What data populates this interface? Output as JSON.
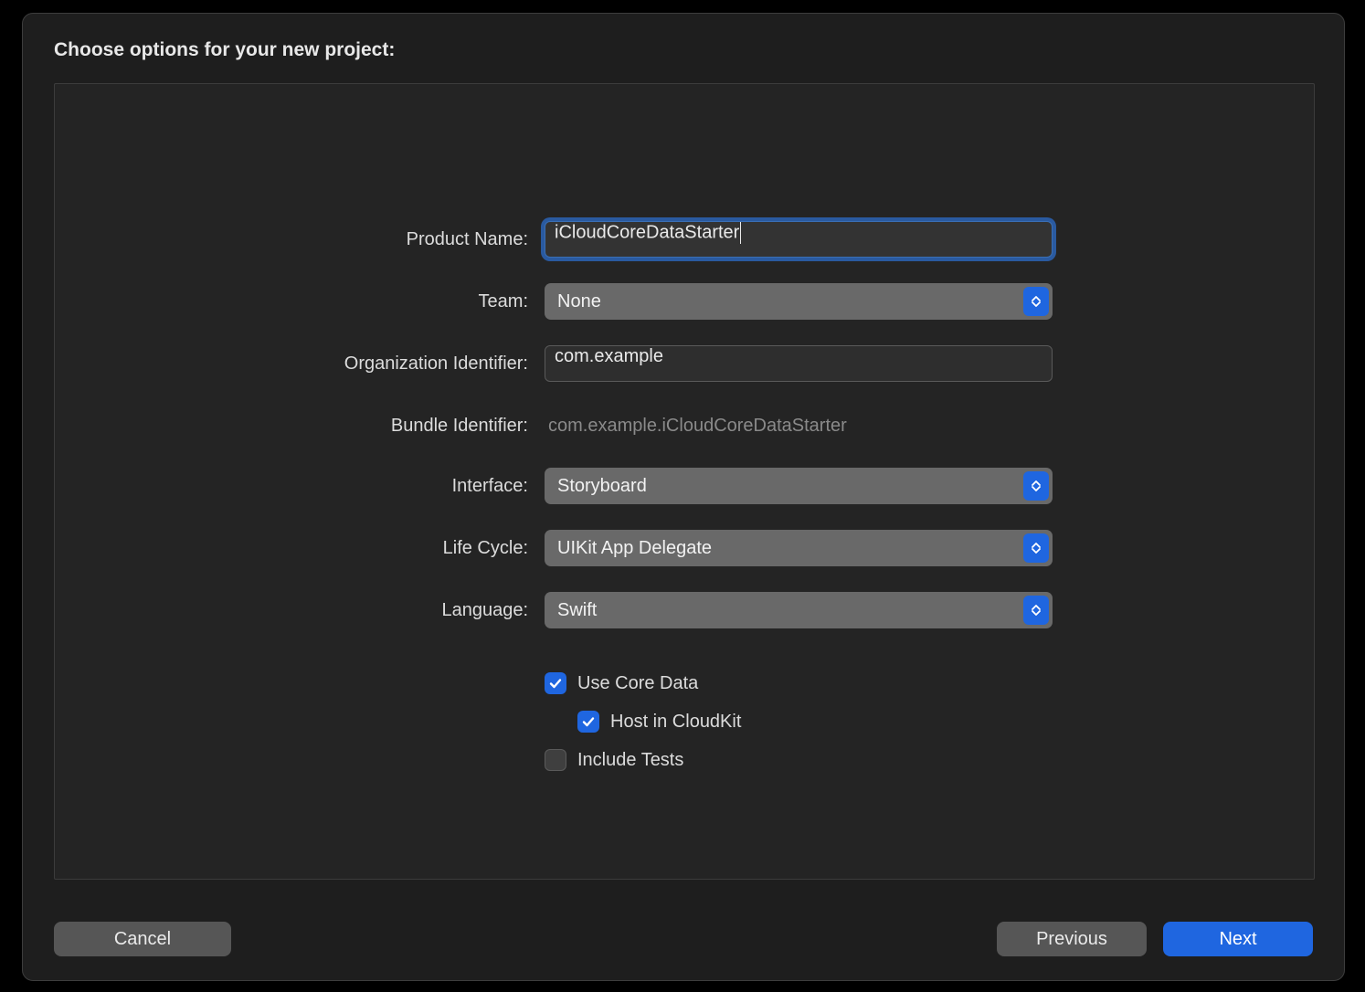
{
  "dialog": {
    "title": "Choose options for your new project:"
  },
  "fields": {
    "product_name": {
      "label": "Product Name:",
      "value": "iCloudCoreDataStarter"
    },
    "team": {
      "label": "Team:",
      "value": "None"
    },
    "org_id": {
      "label": "Organization Identifier:",
      "value": "com.example"
    },
    "bundle_id": {
      "label": "Bundle Identifier:",
      "value": "com.example.iCloudCoreDataStarter"
    },
    "interface": {
      "label": "Interface:",
      "value": "Storyboard"
    },
    "life_cycle": {
      "label": "Life Cycle:",
      "value": "UIKit App Delegate"
    },
    "language": {
      "label": "Language:",
      "value": "Swift"
    }
  },
  "checkboxes": {
    "use_core_data": {
      "label": "Use Core Data",
      "checked": true
    },
    "host_cloudkit": {
      "label": "Host in CloudKit",
      "checked": true
    },
    "include_tests": {
      "label": "Include Tests",
      "checked": false
    }
  },
  "buttons": {
    "cancel": "Cancel",
    "previous": "Previous",
    "next": "Next"
  }
}
